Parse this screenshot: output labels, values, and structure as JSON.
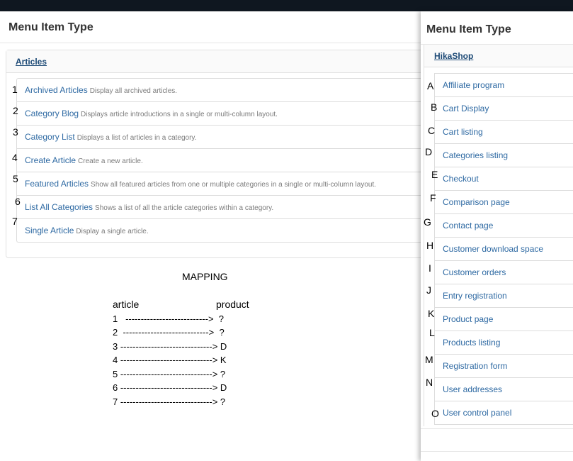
{
  "left": {
    "title": "Menu Item Type",
    "section": "Articles",
    "items": [
      {
        "num": "1",
        "title": "Archived Articles",
        "desc": "Display all archived articles."
      },
      {
        "num": "2",
        "title": "Category Blog",
        "desc": "Displays article introductions in a single or multi-column layout."
      },
      {
        "num": "3",
        "title": "Category List",
        "desc": "Displays a list of articles in a category."
      },
      {
        "num": "4",
        "title": "Create Article",
        "desc": "Create a new article."
      },
      {
        "num": "5",
        "title": "Featured Articles",
        "desc": "Show all featured articles from one or multiple categories in a single or multi-column layout."
      },
      {
        "num": "6",
        "title": "List All Categories",
        "desc": "Shows a list of all the article categories within a category."
      },
      {
        "num": "7",
        "title": "Single Article",
        "desc": "Display a single article."
      }
    ]
  },
  "mapping": {
    "title": "MAPPING",
    "col_left": "article",
    "col_right": "product",
    "lines": [
      "1   --------------------------->  ?",
      "2  ---------------------------->  ?",
      "3 ------------------------------> D",
      "4 ------------------------------> K",
      "5 ------------------------------> ?",
      "6 ------------------------------> D",
      "7 ------------------------------> ?"
    ]
  },
  "right": {
    "title": "Menu Item Type",
    "section": "HikaShop",
    "items": [
      {
        "letter": "A",
        "title": "Affiliate program"
      },
      {
        "letter": "B",
        "title": "Cart Display"
      },
      {
        "letter": "C",
        "title": "Cart listing"
      },
      {
        "letter": "D",
        "title": "Categories listing"
      },
      {
        "letter": "E",
        "title": "Checkout"
      },
      {
        "letter": "F",
        "title": "Comparison page"
      },
      {
        "letter": "G",
        "title": "Contact page"
      },
      {
        "letter": "H",
        "title": "Customer download space"
      },
      {
        "letter": "I",
        "title": "Customer orders"
      },
      {
        "letter": "J",
        "title": "Entry registration"
      },
      {
        "letter": "K",
        "title": "Product page"
      },
      {
        "letter": "L",
        "title": "Products listing"
      },
      {
        "letter": "M",
        "title": "Registration form"
      },
      {
        "letter": "N",
        "title": "User addresses"
      },
      {
        "letter": "O",
        "title": "User control panel"
      }
    ]
  }
}
